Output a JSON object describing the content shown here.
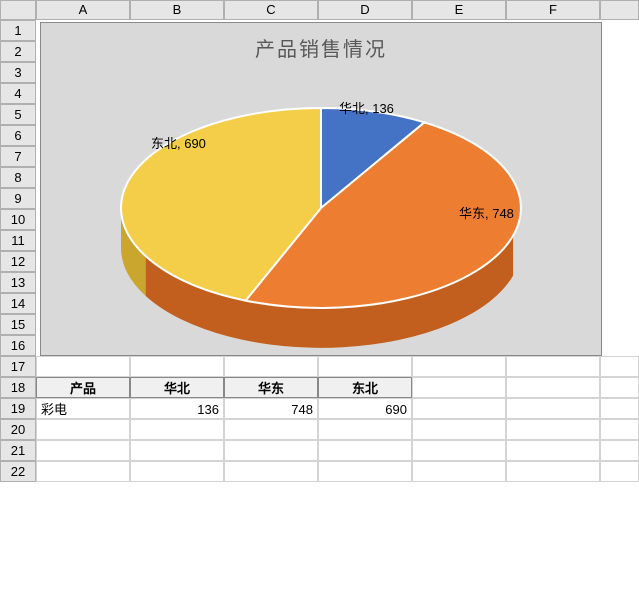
{
  "columns": {
    "A": "A",
    "B": "B",
    "C": "C",
    "D": "D",
    "E": "E",
    "F": "F"
  },
  "rows": [
    "1",
    "2",
    "3",
    "4",
    "5",
    "6",
    "7",
    "8",
    "9",
    "10",
    "11",
    "12",
    "13",
    "14",
    "15",
    "16",
    "17",
    "18",
    "19",
    "20",
    "21",
    "22"
  ],
  "table": {
    "header": {
      "prod": "产品",
      "c1": "华北",
      "c2": "华东",
      "c3": "东北"
    },
    "row": {
      "name": "彩电",
      "v1": "136",
      "v2": "748",
      "v3": "690"
    }
  },
  "chart_data": {
    "type": "pie",
    "title": "产品销售情况",
    "categories": [
      "华北",
      "华东",
      "东北"
    ],
    "values": [
      136,
      748,
      690
    ],
    "colors": [
      "#4472c4",
      "#ed7d31",
      "#f4cd49"
    ],
    "labels": [
      "华北, 136",
      "华东, 748",
      "东北, 690"
    ]
  }
}
